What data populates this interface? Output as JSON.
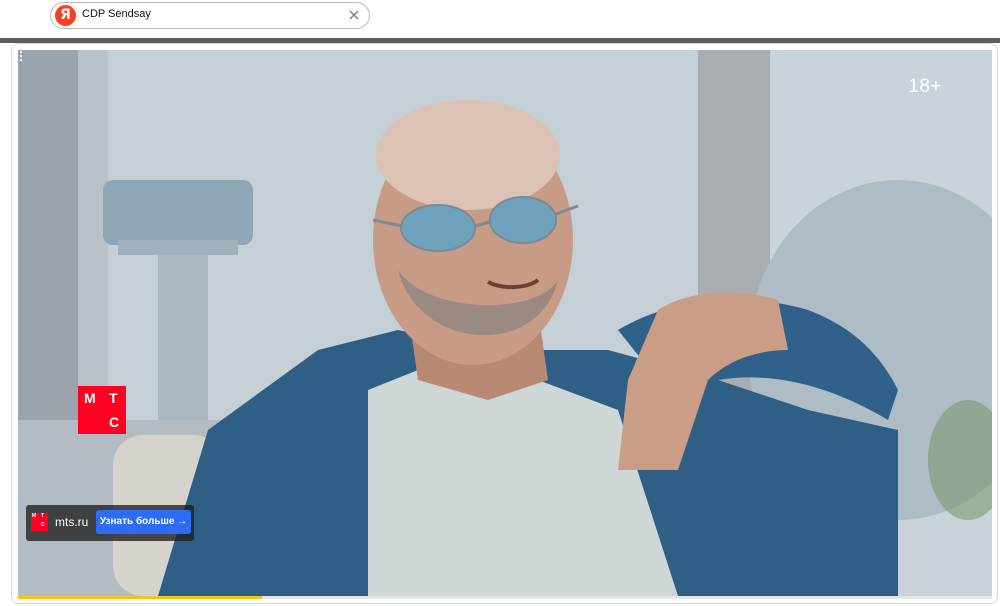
{
  "search": {
    "logo_letter": "Я",
    "query": "CDP Sendsay",
    "clear_icon": "close-icon"
  },
  "ad": {
    "age_rating": "18+",
    "more_icon": "more-vertical-icon",
    "brand_logo": {
      "row1a": "М",
      "row1b": "Т",
      "row2": "С"
    },
    "cta": {
      "mini_logo": {
        "row1a": "М",
        "row1b": "Т",
        "row2": "С"
      },
      "domain": "mts.ru",
      "button_label": "Узнать больше →"
    },
    "progress": 0.25,
    "colors": {
      "brand_red": "#ff0023",
      "cta_blue": "#2f6cf6",
      "progress_yellow": "#f6c21b"
    }
  }
}
